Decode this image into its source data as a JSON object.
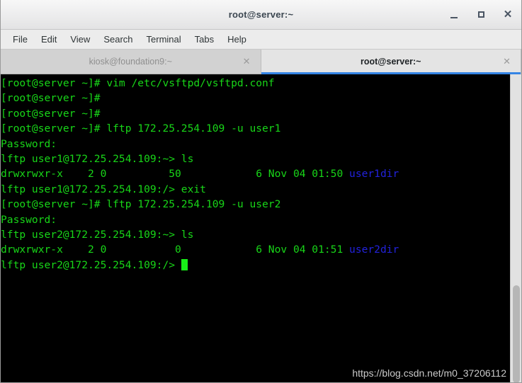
{
  "window": {
    "title": "root@server:~",
    "controls": [
      {
        "name": "minimize",
        "label": "_"
      },
      {
        "name": "maximize",
        "label": "□"
      },
      {
        "name": "close",
        "label": "✕"
      }
    ]
  },
  "menubar": {
    "items": [
      "File",
      "Edit",
      "View",
      "Search",
      "Terminal",
      "Tabs",
      "Help"
    ]
  },
  "tabs": [
    {
      "label": "kiosk@foundation9:~",
      "active": false,
      "close_label": "✕"
    },
    {
      "label": "root@server:~",
      "active": true,
      "close_label": "✕"
    }
  ],
  "terminal": {
    "prompt_root": "[root@server ~]#",
    "lines": [
      {
        "text": "[root@server ~]# vim /etc/vsftpd/vsftpd.conf",
        "color": "green"
      },
      {
        "text": "[root@server ~]#",
        "color": "green"
      },
      {
        "text": "[root@server ~]#",
        "color": "green"
      },
      {
        "text": "[root@server ~]# lftp 172.25.254.109 -u user1",
        "color": "green"
      },
      {
        "text": "Password:",
        "color": "green"
      },
      {
        "text": "lftp user1@172.25.254.109:~> ls",
        "color": "green"
      },
      {
        "text": "drwxrwxr-x    2 0          50            6 Nov 04 01:50 ",
        "color": "green",
        "suffix": "user1dir",
        "suffix_color": "blue"
      },
      {
        "text": "lftp user1@172.25.254.109:/> exit",
        "color": "green"
      },
      {
        "text": "[root@server ~]# lftp 172.25.254.109 -u user2",
        "color": "green"
      },
      {
        "text": "Password:",
        "color": "green"
      },
      {
        "text": "lftp user2@172.25.254.109:~> ls",
        "color": "green"
      },
      {
        "text": "drwxrwxr-x    2 0           0            6 Nov 04 01:51 ",
        "color": "green",
        "suffix": "user2dir",
        "suffix_color": "blue"
      },
      {
        "text": "lftp user2@172.25.254.109:/> ",
        "color": "green",
        "cursor": true
      }
    ],
    "colors": {
      "background": "#000000",
      "foreground": "#18d618",
      "directory": "#2222dd",
      "cursor": "#18f018"
    }
  },
  "watermark": {
    "text": "https://blog.csdn.net/m0_37206112"
  },
  "scrollbar": {
    "name": "vertical-scrollbar"
  }
}
